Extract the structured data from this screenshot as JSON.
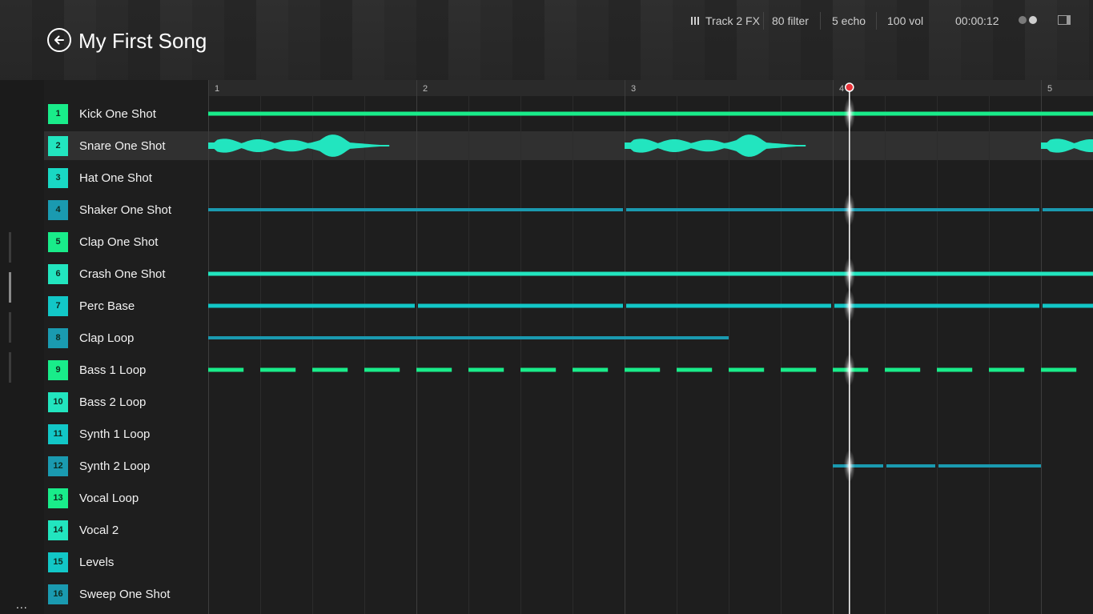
{
  "song": {
    "title": "My First Song"
  },
  "toolbar": {
    "track_fx": "Track 2 FX",
    "filter": "80 filter",
    "echo": "5 echo",
    "volume": "100 vol",
    "time": "00:00:12",
    "more": "..."
  },
  "timeline": {
    "bars": [
      "1",
      "2",
      "3",
      "4",
      "5"
    ],
    "bars_visible": 4.25,
    "playhead_bar": 3.08
  },
  "colors": {
    "green": "#19ec8a",
    "aqua": "#22e5bf",
    "teal": "#12c7c7",
    "blue": "#1a9ab0",
    "playhead_dot": "#e8333a"
  },
  "tracks": [
    {
      "num": "1",
      "name": "Kick One Shot",
      "color": "#19ec8a",
      "selected": false,
      "clip": {
        "style": "line",
        "start": 0,
        "end": 4.25,
        "thickness": 5
      }
    },
    {
      "num": "2",
      "name": "Snare One Shot",
      "color": "#22e5bf",
      "selected": true,
      "clip": {
        "style": "wave",
        "hits": [
          0,
          2,
          4
        ]
      }
    },
    {
      "num": "3",
      "name": "Hat One Shot",
      "color": "#19d8c4",
      "selected": false,
      "clip": null
    },
    {
      "num": "4",
      "name": "Shaker One Shot",
      "color": "#1a9ab0",
      "selected": false,
      "clip": {
        "style": "line",
        "start": 0,
        "end": 4.25,
        "thickness": 4,
        "gaps": [
          2,
          4
        ]
      }
    },
    {
      "num": "5",
      "name": "Clap One Shot",
      "color": "#19ec8a",
      "selected": false,
      "clip": null
    },
    {
      "num": "6",
      "name": "Crash One Shot",
      "color": "#22e5bf",
      "selected": false,
      "clip": {
        "style": "line",
        "start": 0,
        "end": 4.25,
        "thickness": 5
      }
    },
    {
      "num": "7",
      "name": "Perc Base",
      "color": "#12c7c7",
      "selected": false,
      "clip": {
        "style": "line",
        "start": 0,
        "end": 4.25,
        "thickness": 5,
        "gaps": [
          1,
          2,
          3,
          4
        ]
      }
    },
    {
      "num": "8",
      "name": "Clap Loop",
      "color": "#1a9ab0",
      "selected": false,
      "clip": {
        "style": "line",
        "start": 0,
        "end": 2.5,
        "thickness": 4
      }
    },
    {
      "num": "9",
      "name": "Bass 1 Loop",
      "color": "#19ec8a",
      "selected": false,
      "clip": {
        "style": "dashed",
        "start": 0,
        "end": 4.17,
        "thickness": 5
      }
    },
    {
      "num": "10",
      "name": "Bass 2 Loop",
      "color": "#22e5bf",
      "selected": false,
      "clip": null
    },
    {
      "num": "11",
      "name": "Synth 1 Loop",
      "color": "#12c7c7",
      "selected": false,
      "clip": null
    },
    {
      "num": "12",
      "name": "Synth 2 Loop",
      "color": "#1a9ab0",
      "selected": false,
      "clip": {
        "style": "line",
        "start": 3,
        "end": 4,
        "thickness": 4,
        "gaps": [
          3.25,
          3.5
        ]
      }
    },
    {
      "num": "13",
      "name": "Vocal Loop",
      "color": "#19ec8a",
      "selected": false,
      "clip": null
    },
    {
      "num": "14",
      "name": "Vocal 2",
      "color": "#22e5bf",
      "selected": false,
      "clip": null
    },
    {
      "num": "15",
      "name": "Levels",
      "color": "#12c7c7",
      "selected": false,
      "clip": null
    },
    {
      "num": "16",
      "name": "Sweep One Shot",
      "color": "#1a9ab0",
      "selected": false,
      "clip": null
    }
  ]
}
